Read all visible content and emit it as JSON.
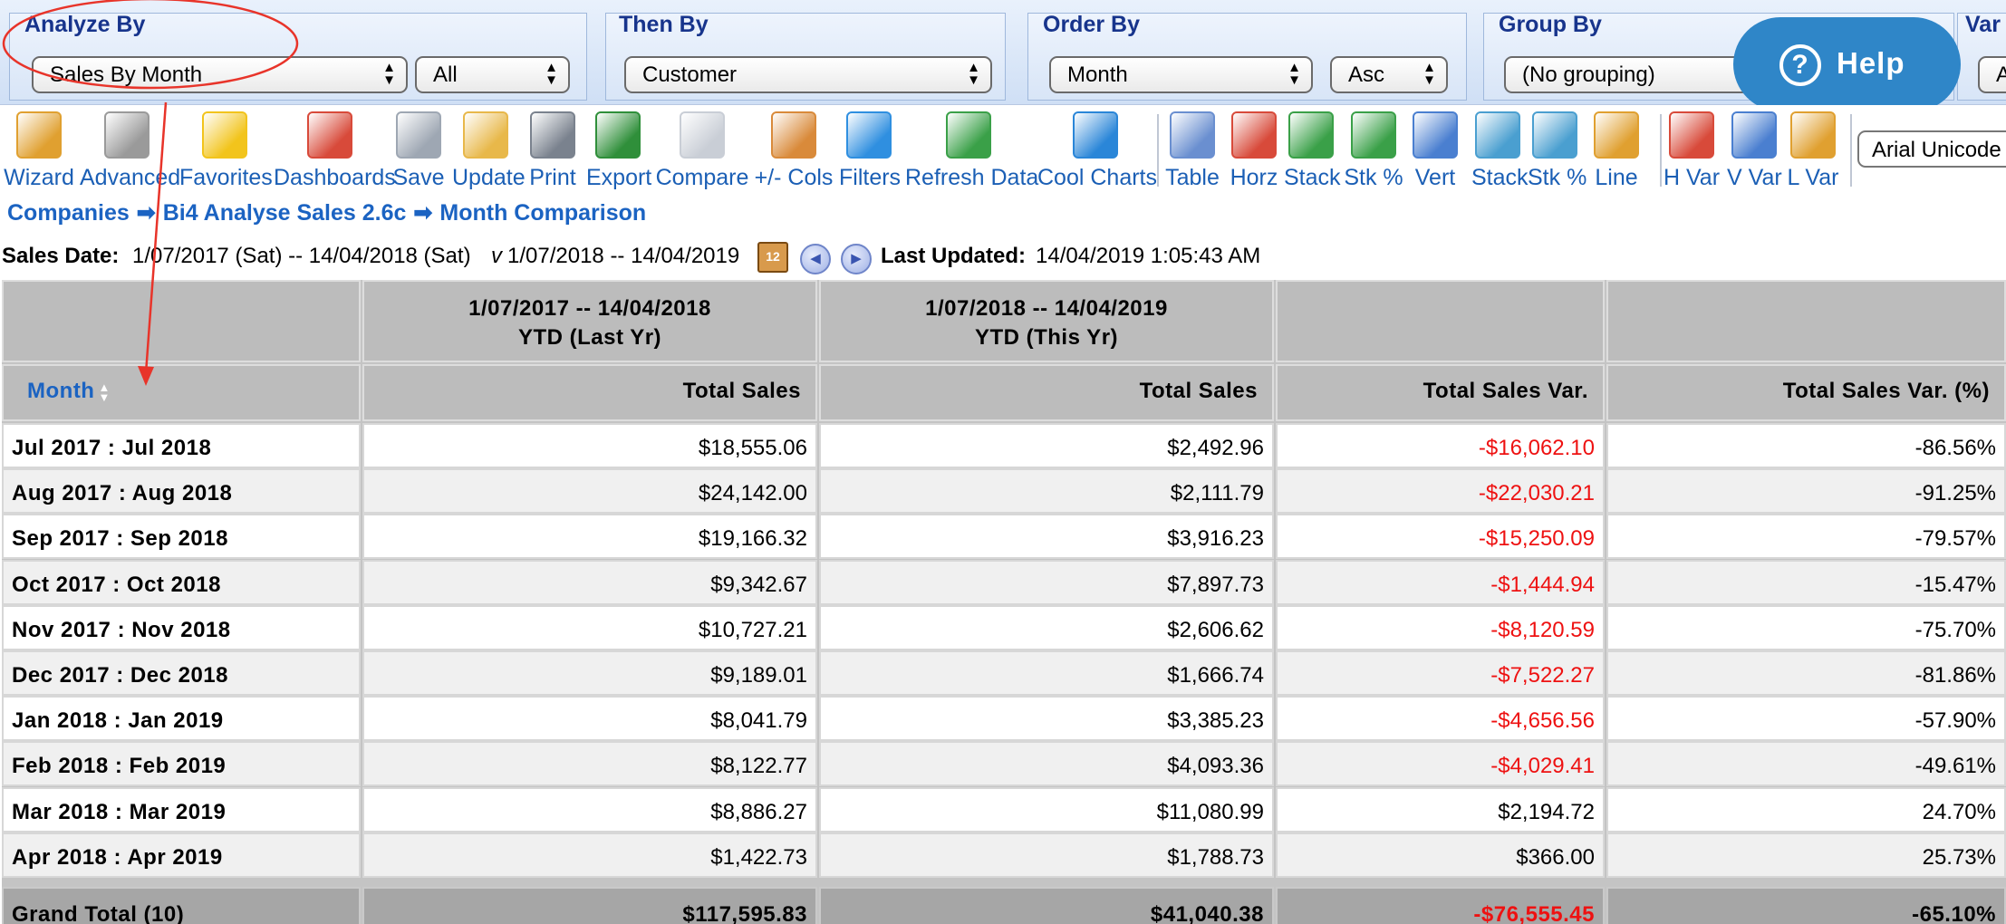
{
  "app": {
    "help_label": "Help",
    "help_glyph": "?"
  },
  "options": {
    "analyze_by": {
      "title": "Analyze By",
      "value": "Sales By Month",
      "filter_value": "All"
    },
    "then_by": {
      "title": "Then By",
      "value": "Customer"
    },
    "order_by": {
      "title": "Order By",
      "value": "Month",
      "direction": "Asc"
    },
    "group_by": {
      "title": "Group By",
      "value": "(No grouping)"
    },
    "var": {
      "title": "Var",
      "value": "A"
    }
  },
  "toolbar": {
    "items": [
      {
        "label": "Wizard",
        "icon": "wizard-icon",
        "color": "#e0a030"
      },
      {
        "label": "Advanced",
        "icon": "gear-icon",
        "color": "#9a9a9a"
      },
      {
        "label": "Favorites",
        "icon": "star-icon",
        "color": "#f2c41c"
      },
      {
        "label": "Dashboards",
        "icon": "dashboard-icon",
        "color": "#d84a3a"
      },
      {
        "label": "Save",
        "icon": "floppy-icon",
        "color": "#9ea7b3"
      },
      {
        "label": "Update",
        "icon": "edit-icon",
        "color": "#e8b84a"
      },
      {
        "label": "Print",
        "icon": "printer-icon",
        "color": "#7a828e"
      },
      {
        "label": "Export",
        "icon": "excel-icon",
        "color": "#2f8f3a"
      },
      {
        "label": "Compare",
        "icon": "copy-icon",
        "color": "#c9ced6"
      },
      {
        "label": "+/- Cols",
        "icon": "columns-icon",
        "color": "#d98a3a"
      },
      {
        "label": "Filters",
        "icon": "funnel-icon",
        "color": "#2f8fe0"
      },
      {
        "label": "Refresh Data",
        "icon": "refresh-icon",
        "color": "#3aa048"
      },
      {
        "label": "Cool Charts",
        "icon": "cool-charts-icon",
        "color": "#2a86d8"
      },
      {
        "label": "Table",
        "icon": "table-icon",
        "color": "#6a8fd0"
      },
      {
        "label": "Horz",
        "icon": "horizontal-bar-icon",
        "color": "#d84a3a"
      },
      {
        "label": "Stack",
        "icon": "stacked-bar-icon",
        "color": "#3aa048"
      },
      {
        "label": "Stk %",
        "icon": "stacked-percent-icon",
        "color": "#3aa048"
      },
      {
        "label": "Vert",
        "icon": "vertical-bar-icon",
        "color": "#4a7fd0"
      },
      {
        "label": "Stack",
        "icon": "stacked-column-icon",
        "color": "#4a9fd0"
      },
      {
        "label": "Stk %",
        "icon": "stacked-column-percent-icon",
        "color": "#4a9fd0"
      },
      {
        "label": "Line",
        "icon": "line-chart-icon",
        "color": "#e0a030"
      },
      {
        "label": "H Var",
        "icon": "horizontal-variance-icon",
        "color": "#d84a3a"
      },
      {
        "label": "V Var",
        "icon": "vertical-variance-icon",
        "color": "#4a7fd0"
      },
      {
        "label": "L Var",
        "icon": "line-variance-icon",
        "color": "#e0a030"
      }
    ],
    "font_select": "Arial Unicode"
  },
  "breadcrumb": {
    "items": [
      "Companies",
      "Bi4 Analyse Sales 2.6c",
      "Month Comparison"
    ],
    "separator": "➡"
  },
  "dates": {
    "sales_label": "Sales Date:",
    "sales_value": "1/07/2017 (Sat) -- 14/04/2018 (Sat)",
    "vs": "v",
    "compare_value": "1/07/2018 -- 14/04/2019",
    "calendar_glyph": "12",
    "updated_label": "Last Updated:",
    "updated_value": "14/04/2019 1:05:43 AM"
  },
  "table": {
    "periods": [
      {
        "line1": "",
        "line2": ""
      },
      {
        "line1": "1/07/2017 -- 14/04/2018",
        "line2": "YTD (Last Yr)"
      },
      {
        "line1": "1/07/2018 -- 14/04/2019",
        "line2": "YTD (This Yr)"
      },
      {
        "line1": "",
        "line2": ""
      },
      {
        "line1": "",
        "line2": ""
      }
    ],
    "columns": [
      "Month",
      "Total Sales",
      "Total Sales",
      "Total Sales Var.",
      "Total Sales Var. (%)"
    ],
    "rows": [
      {
        "month": "Jul 2017 : Jul 2018",
        "last": "$18,555.06",
        "this": "$2,492.96",
        "var": "-$16,062.10",
        "pct": "-86.56%",
        "negative": true
      },
      {
        "month": "Aug 2017 : Aug 2018",
        "last": "$24,142.00",
        "this": "$2,111.79",
        "var": "-$22,030.21",
        "pct": "-91.25%",
        "negative": true
      },
      {
        "month": "Sep 2017 : Sep 2018",
        "last": "$19,166.32",
        "this": "$3,916.23",
        "var": "-$15,250.09",
        "pct": "-79.57%",
        "negative": true
      },
      {
        "month": "Oct 2017 : Oct 2018",
        "last": "$9,342.67",
        "this": "$7,897.73",
        "var": "-$1,444.94",
        "pct": "-15.47%",
        "negative": true
      },
      {
        "month": "Nov 2017 : Nov 2018",
        "last": "$10,727.21",
        "this": "$2,606.62",
        "var": "-$8,120.59",
        "pct": "-75.70%",
        "negative": true
      },
      {
        "month": "Dec 2017 : Dec 2018",
        "last": "$9,189.01",
        "this": "$1,666.74",
        "var": "-$7,522.27",
        "pct": "-81.86%",
        "negative": true
      },
      {
        "month": "Jan 2018 : Jan 2019",
        "last": "$8,041.79",
        "this": "$3,385.23",
        "var": "-$4,656.56",
        "pct": "-57.90%",
        "negative": true
      },
      {
        "month": "Feb 2018 : Feb 2019",
        "last": "$8,122.77",
        "this": "$4,093.36",
        "var": "-$4,029.41",
        "pct": "-49.61%",
        "negative": true
      },
      {
        "month": "Mar 2018 : Mar 2019",
        "last": "$8,886.27",
        "this": "$11,080.99",
        "var": "$2,194.72",
        "pct": "24.70%",
        "negative": false
      },
      {
        "month": "Apr 2018 : Apr 2019",
        "last": "$1,422.73",
        "this": "$1,788.73",
        "var": "$366.00",
        "pct": "25.73%",
        "negative": false
      }
    ],
    "total": {
      "label": "Grand Total (10)",
      "last": "$117,595.83",
      "this": "$41,040.38",
      "var": "-$76,555.45",
      "pct": "-65.10%",
      "negative": true
    }
  },
  "colors": {
    "accent": "#1b63c2",
    "negative": "#ee1111",
    "annotation": "#e8342a",
    "help": "#2f86c8"
  }
}
